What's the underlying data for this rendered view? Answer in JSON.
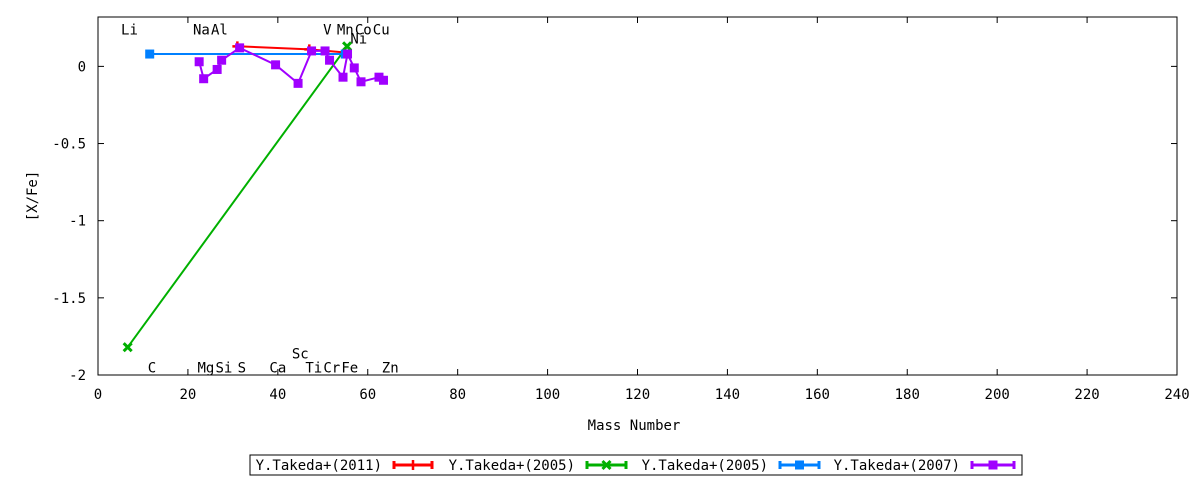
{
  "chart_data": {
    "type": "line",
    "title": "",
    "xlabel": "Mass Number",
    "ylabel": "[X/Fe]",
    "xlim": [
      0,
      240
    ],
    "ylim": [
      -2,
      0.32
    ],
    "xticks": [
      0,
      20,
      40,
      60,
      80,
      100,
      120,
      140,
      160,
      180,
      200,
      220,
      240
    ],
    "yticks": [
      -2,
      -1.5,
      -1,
      -0.5,
      0
    ],
    "ytick_labels": [
      "-2",
      "-1.5",
      "-1",
      "-0.5",
      "0"
    ],
    "grid": false,
    "legend_position": "bottom-center",
    "element_labels_top": [
      {
        "label": "Li",
        "x": 7,
        "y": 0.24
      },
      {
        "label": "Na",
        "x": 23,
        "y": 0.24
      },
      {
        "label": "Al",
        "x": 27,
        "y": 0.24
      },
      {
        "label": "V",
        "x": 51,
        "y": 0.24
      },
      {
        "label": "Mn",
        "x": 55,
        "y": 0.24
      },
      {
        "label": "Co",
        "x": 59,
        "y": 0.24
      },
      {
        "label": "Cu",
        "x": 63,
        "y": 0.24
      },
      {
        "label": "Ni",
        "x": 58,
        "y": 0.18
      }
    ],
    "element_labels_bottom": [
      {
        "label": "C",
        "x": 12,
        "y": -1.95
      },
      {
        "label": "Mg",
        "x": 24,
        "y": -1.95
      },
      {
        "label": "Si",
        "x": 28,
        "y": -1.95
      },
      {
        "label": "S",
        "x": 32,
        "y": -1.95
      },
      {
        "label": "Ca",
        "x": 40,
        "y": -1.95
      },
      {
        "label": "Sc",
        "x": 45,
        "y": -1.86
      },
      {
        "label": "Ti",
        "x": 48,
        "y": -1.95
      },
      {
        "label": "Cr",
        "x": 52,
        "y": -1.95
      },
      {
        "label": "Fe",
        "x": 56,
        "y": -1.95
      },
      {
        "label": "Zn",
        "x": 65,
        "y": -1.95
      }
    ],
    "series": [
      {
        "name": "Y.Takeda+(2011)",
        "color": "#ff0000",
        "marker": "plus",
        "points": [
          [
            31,
            0.13
          ],
          [
            47,
            0.11
          ],
          [
            55,
            0.09
          ]
        ]
      },
      {
        "name": "Y.Takeda+(2005)",
        "color": "#00b000",
        "marker": "cross",
        "points": [
          [
            6.6,
            -1.82
          ],
          [
            55.4,
            0.13
          ]
        ]
      },
      {
        "name": "Y.Takeda+(2005)",
        "color": "#0080ff",
        "marker": "square",
        "points": [
          [
            11.5,
            0.08
          ],
          [
            55,
            0.08
          ]
        ]
      },
      {
        "name": "Y.Takeda+(2007)",
        "color": "#a000ff",
        "marker": "square",
        "points": [
          [
            22.5,
            0.03
          ],
          [
            23.5,
            -0.08
          ],
          [
            26.5,
            -0.02
          ],
          [
            27.5,
            0.04
          ],
          [
            31.5,
            0.12
          ],
          [
            39.5,
            0.01
          ],
          [
            44.5,
            -0.11
          ],
          [
            47.5,
            0.1
          ],
          [
            50.5,
            0.1
          ],
          [
            51.5,
            0.04
          ],
          [
            54.5,
            -0.07
          ],
          [
            55.5,
            0.08
          ],
          [
            57,
            -0.01
          ],
          [
            58.5,
            -0.1
          ],
          [
            62.5,
            -0.07
          ],
          [
            63.5,
            -0.09
          ]
        ]
      }
    ]
  }
}
